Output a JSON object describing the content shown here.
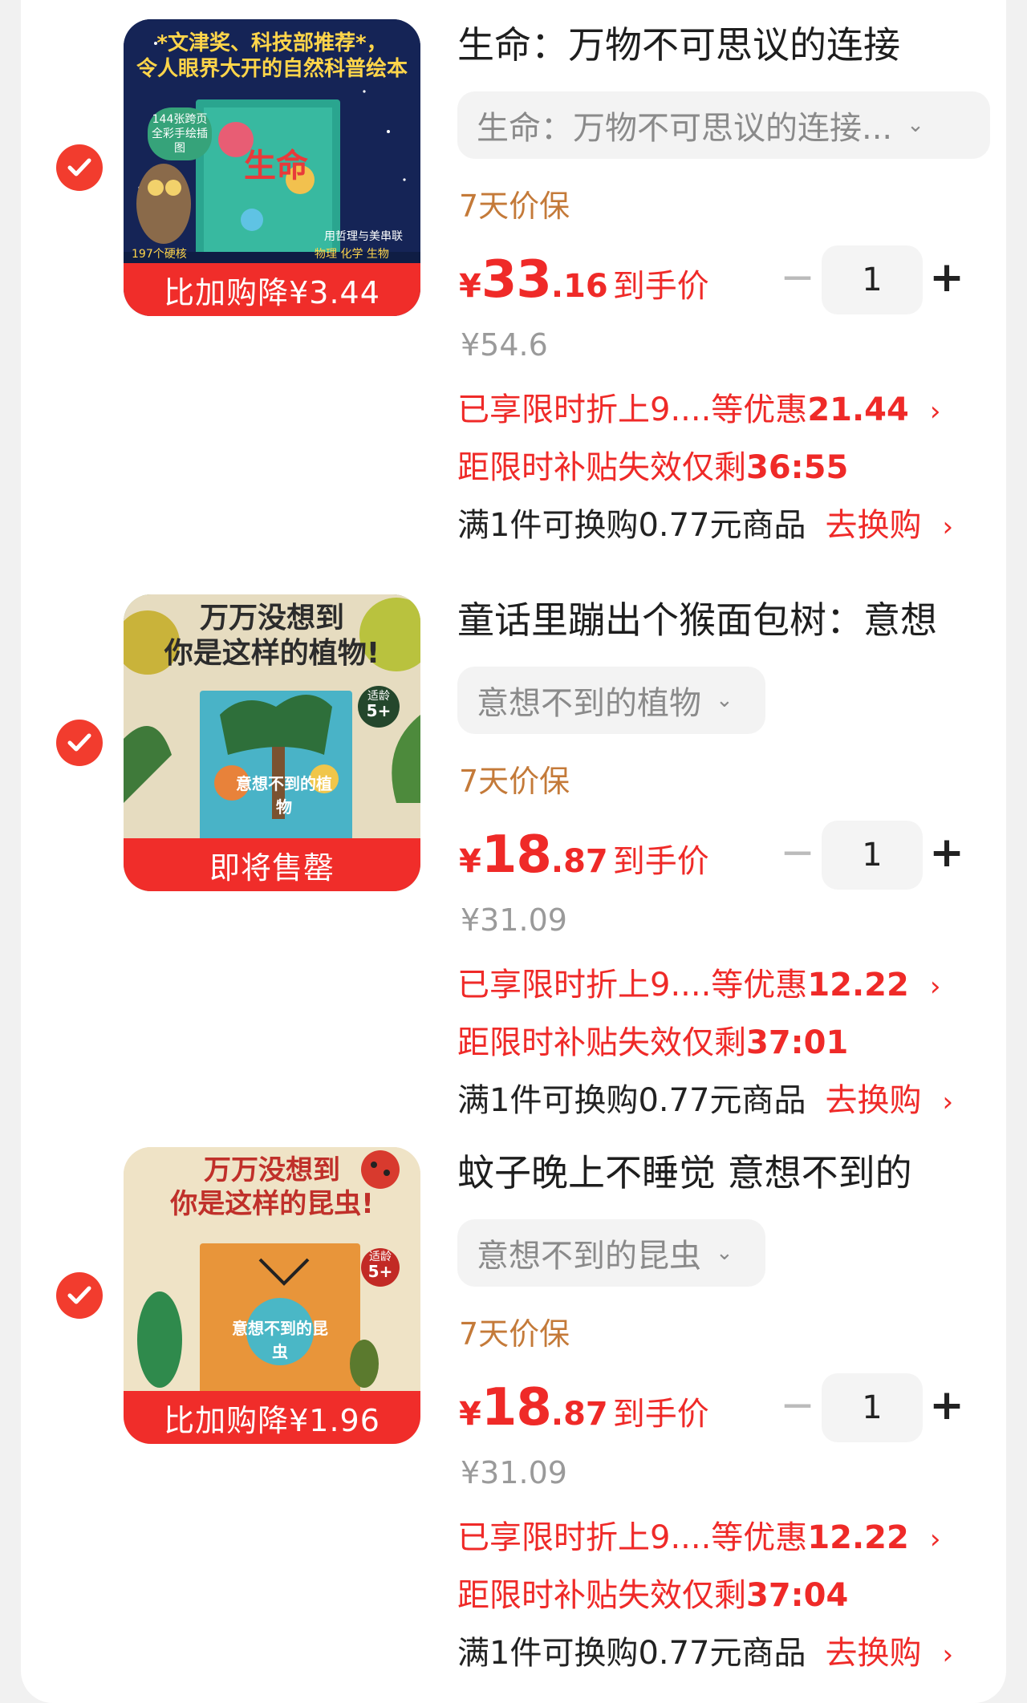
{
  "items": [
    {
      "thumb_band": "比加购降¥3.44",
      "thumb_text": [
        "*文津奖、科技部推荐*，",
        "令人眼界大开的自然科普绘本",
        "144张跨页",
        "全彩手绘插图",
        "生命",
        "用哲理与美串联",
        "197个硬核",
        "物理 化学 生物"
      ],
      "title": "生命：万物不可思议的连接",
      "spec": "生命：万物不可思议的连接...",
      "guarantee": "7天价保",
      "price_yen": "¥",
      "price_int": "33",
      "price_dec": ".16",
      "price_suffix": "到手价",
      "qty": "1",
      "minus": "−",
      "plus": "+",
      "orig_price": "¥54.6",
      "promo_text": "已享限时折上9....等优惠",
      "promo_amount": "21.44",
      "timer_text": "距限时补贴失效仅剩",
      "timer_value": "36:55",
      "swap_text": "满1件可换购0.77元商品",
      "swap_link": "去换购"
    },
    {
      "thumb_band": "即将售罄",
      "thumb_text": [
        "万万没想到",
        "你是这样的植物!",
        "适龄",
        "5+",
        "意想不到的植物"
      ],
      "title": "童话里蹦出个猴面包树：意想",
      "spec": "意想不到的植物",
      "guarantee": "7天价保",
      "price_yen": "¥",
      "price_int": "18",
      "price_dec": ".87",
      "price_suffix": "到手价",
      "qty": "1",
      "minus": "−",
      "plus": "+",
      "orig_price": "¥31.09",
      "promo_text": "已享限时折上9....等优惠",
      "promo_amount": "12.22",
      "timer_text": "距限时补贴失效仅剩",
      "timer_value": "37:01",
      "swap_text": "满1件可换购0.77元商品",
      "swap_link": "去换购"
    },
    {
      "thumb_band": "比加购降¥1.96",
      "thumb_text": [
        "万万没想到",
        "你是这样的昆虫!",
        "适龄",
        "5+",
        "意想不到的昆虫"
      ],
      "title": "蚊子晚上不睡觉 意想不到的",
      "spec": "意想不到的昆虫",
      "guarantee": "7天价保",
      "price_yen": "¥",
      "price_int": "18",
      "price_dec": ".87",
      "price_suffix": "到手价",
      "qty": "1",
      "minus": "−",
      "plus": "+",
      "orig_price": "¥31.09",
      "promo_text": "已享限时折上9....等优惠",
      "promo_amount": "12.22",
      "timer_text": "距限时补贴失效仅剩",
      "timer_value": "37:04",
      "swap_text": "满1件可换购0.77元商品",
      "swap_link": "去换购"
    }
  ],
  "colors": {
    "accent_red": "#ef2a28",
    "guarantee_orange": "#c47a39",
    "check_red": "#f23c2e"
  },
  "icons": {
    "check": "check-icon",
    "chevron_down": "chevron-down-icon",
    "chevron_right": "chevron-right-icon"
  }
}
